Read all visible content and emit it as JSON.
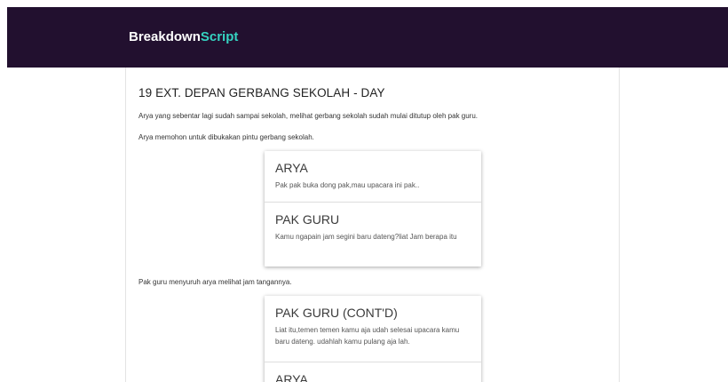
{
  "header": {
    "brand_part1": "Breakdown",
    "brand_part2": "Script",
    "brand_color": "#35d3c1",
    "bar_color": "#22102f"
  },
  "scene": {
    "heading": "19 EXT. DEPAN GERBANG SEKOLAH - DAY",
    "action1": "Arya yang sebentar lagi sudah sampai sekolah, melihat gerbang sekolah sudah mulai ditutup oleh pak guru.",
    "action2": "Arya memohon untuk dibukakan pintu gerbang sekolah.",
    "dialog_group1": [
      {
        "character": "ARYA",
        "line": "Pak pak buka dong pak,mau upacara ini pak.."
      },
      {
        "character": "PAK GURU",
        "line": "Kamu ngapain jam segini baru dateng?liat Jam berapa itu"
      }
    ],
    "action3": "Pak guru menyuruh arya melihat jam tangannya.",
    "dialog_group2": [
      {
        "character": "PAK GURU (CONT'D)",
        "line": "Liat itu,temen temen kamu aja udah selesai upacara kamu baru dateng. udahlah kamu pulang aja lah."
      },
      {
        "character": "ARYA",
        "line": ""
      }
    ]
  }
}
